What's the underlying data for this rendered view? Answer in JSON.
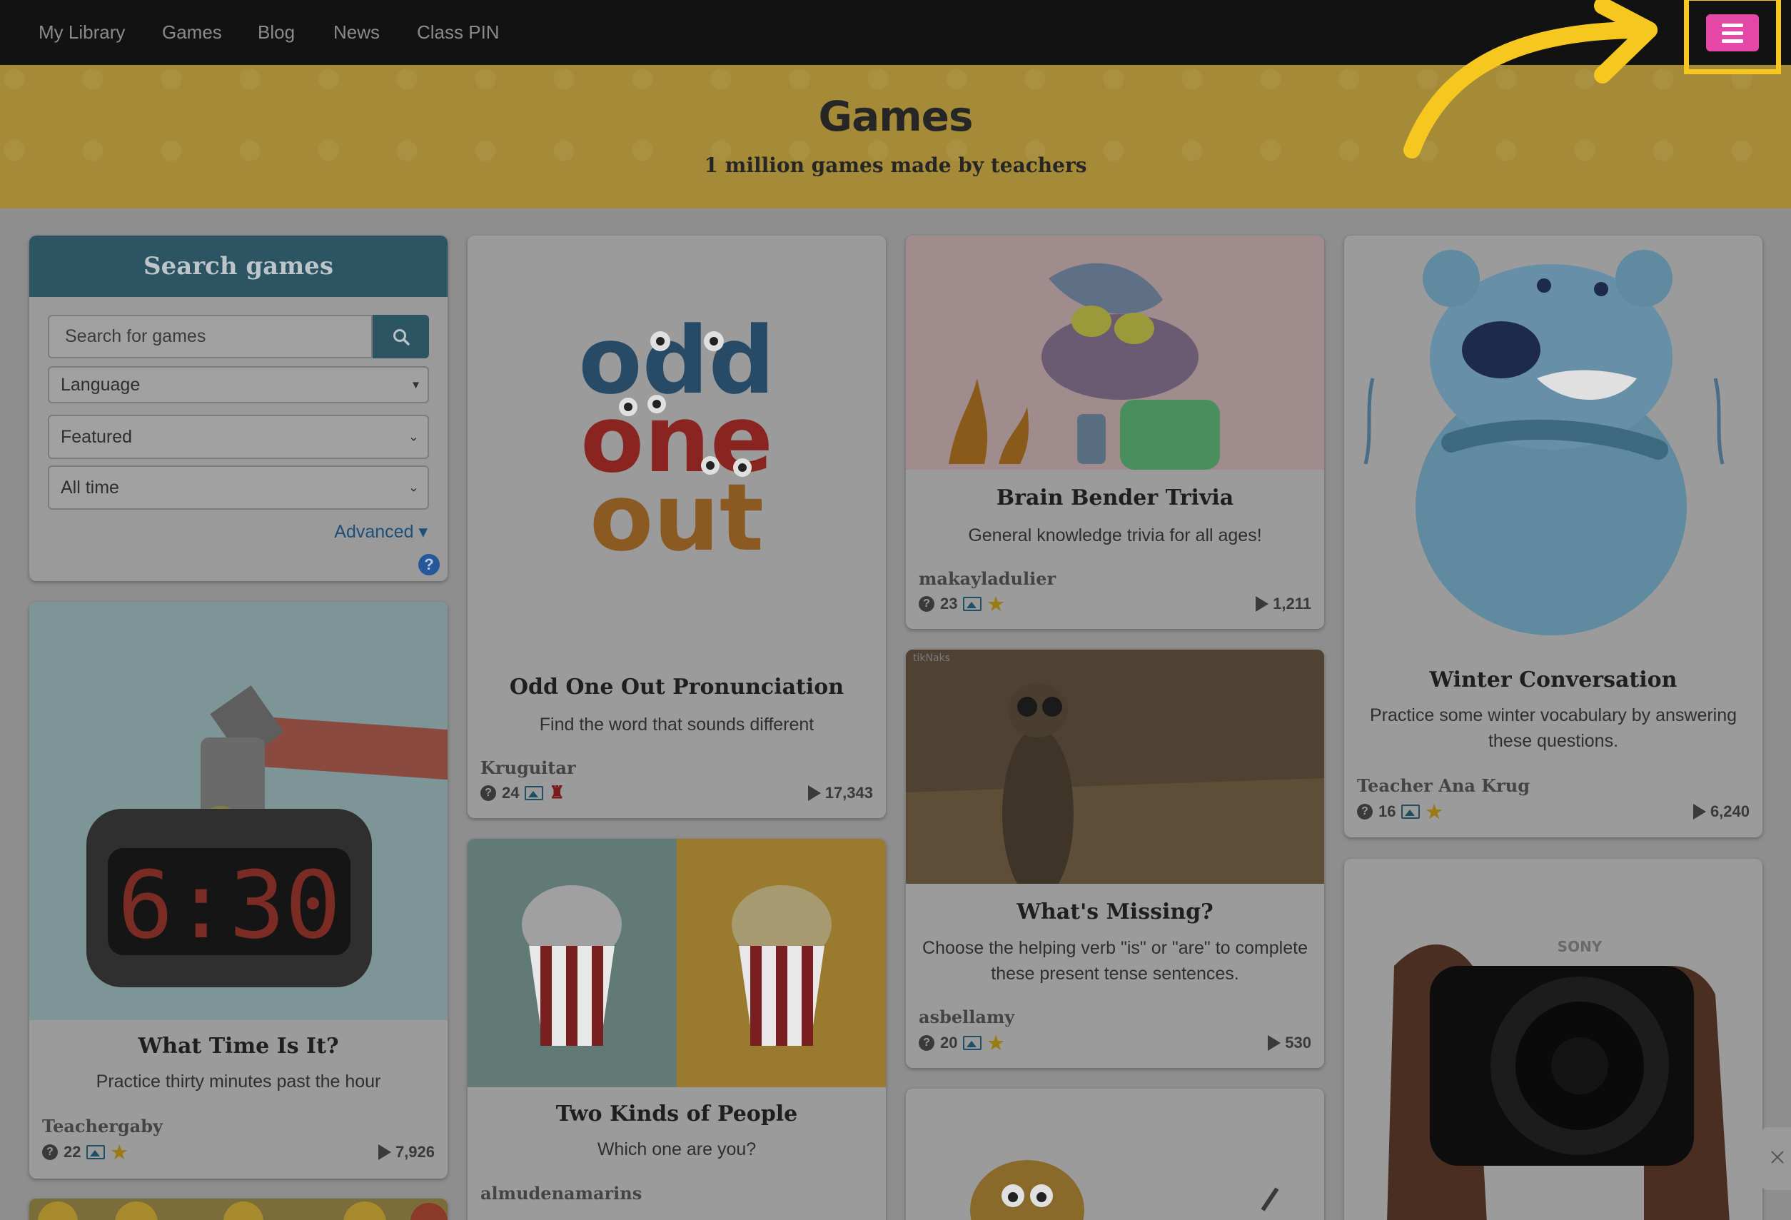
{
  "nav": {
    "links": [
      "My Library",
      "Games",
      "Blog",
      "News",
      "Class PIN"
    ],
    "menu_icon": "hamburger-menu-icon",
    "highlight_color": "#f6c81f"
  },
  "banner": {
    "title": "Games",
    "subtitle": "1 million games made by teachers"
  },
  "search": {
    "heading": "Search games",
    "placeholder": "Search for games",
    "language": "Language",
    "sort": "Featured",
    "period": "All time",
    "advanced": "Advanced",
    "help": "?"
  },
  "cards": {
    "time": {
      "title": "What Time Is It?",
      "desc": "Practice thirty minutes past the hour",
      "author": "Teachergaby",
      "questions": "22",
      "plays": "7,926",
      "clock": "6:30"
    },
    "odd": {
      "title": "Odd One Out Pronunciation",
      "desc": "Find the word that sounds different",
      "author": "Kruguitar",
      "questions": "24",
      "plays": "17,343",
      "art": [
        "odd",
        "one",
        "out"
      ]
    },
    "popcorn": {
      "title": "Two Kinds of People",
      "desc": "Which one are you?",
      "author": "almudenamarins"
    },
    "brain": {
      "title": "Brain Bender Trivia",
      "desc": "General knowledge trivia for all ages!",
      "author": "makayladulier",
      "questions": "23",
      "plays": "1,211"
    },
    "missing": {
      "title": "What's Missing?",
      "desc": "Choose the helping verb \"is\" or \"are\" to complete these present tense sentences.",
      "author": "asbellamy",
      "questions": "20",
      "plays": "530",
      "watermark": "tikNaks"
    },
    "winter": {
      "title": "Winter Conversation",
      "desc": "Practice some winter vocabulary by answering these questions.",
      "author": "Teacher Ana Krug",
      "questions": "16",
      "plays": "6,240"
    },
    "camera": {
      "brand": "SONY"
    }
  }
}
